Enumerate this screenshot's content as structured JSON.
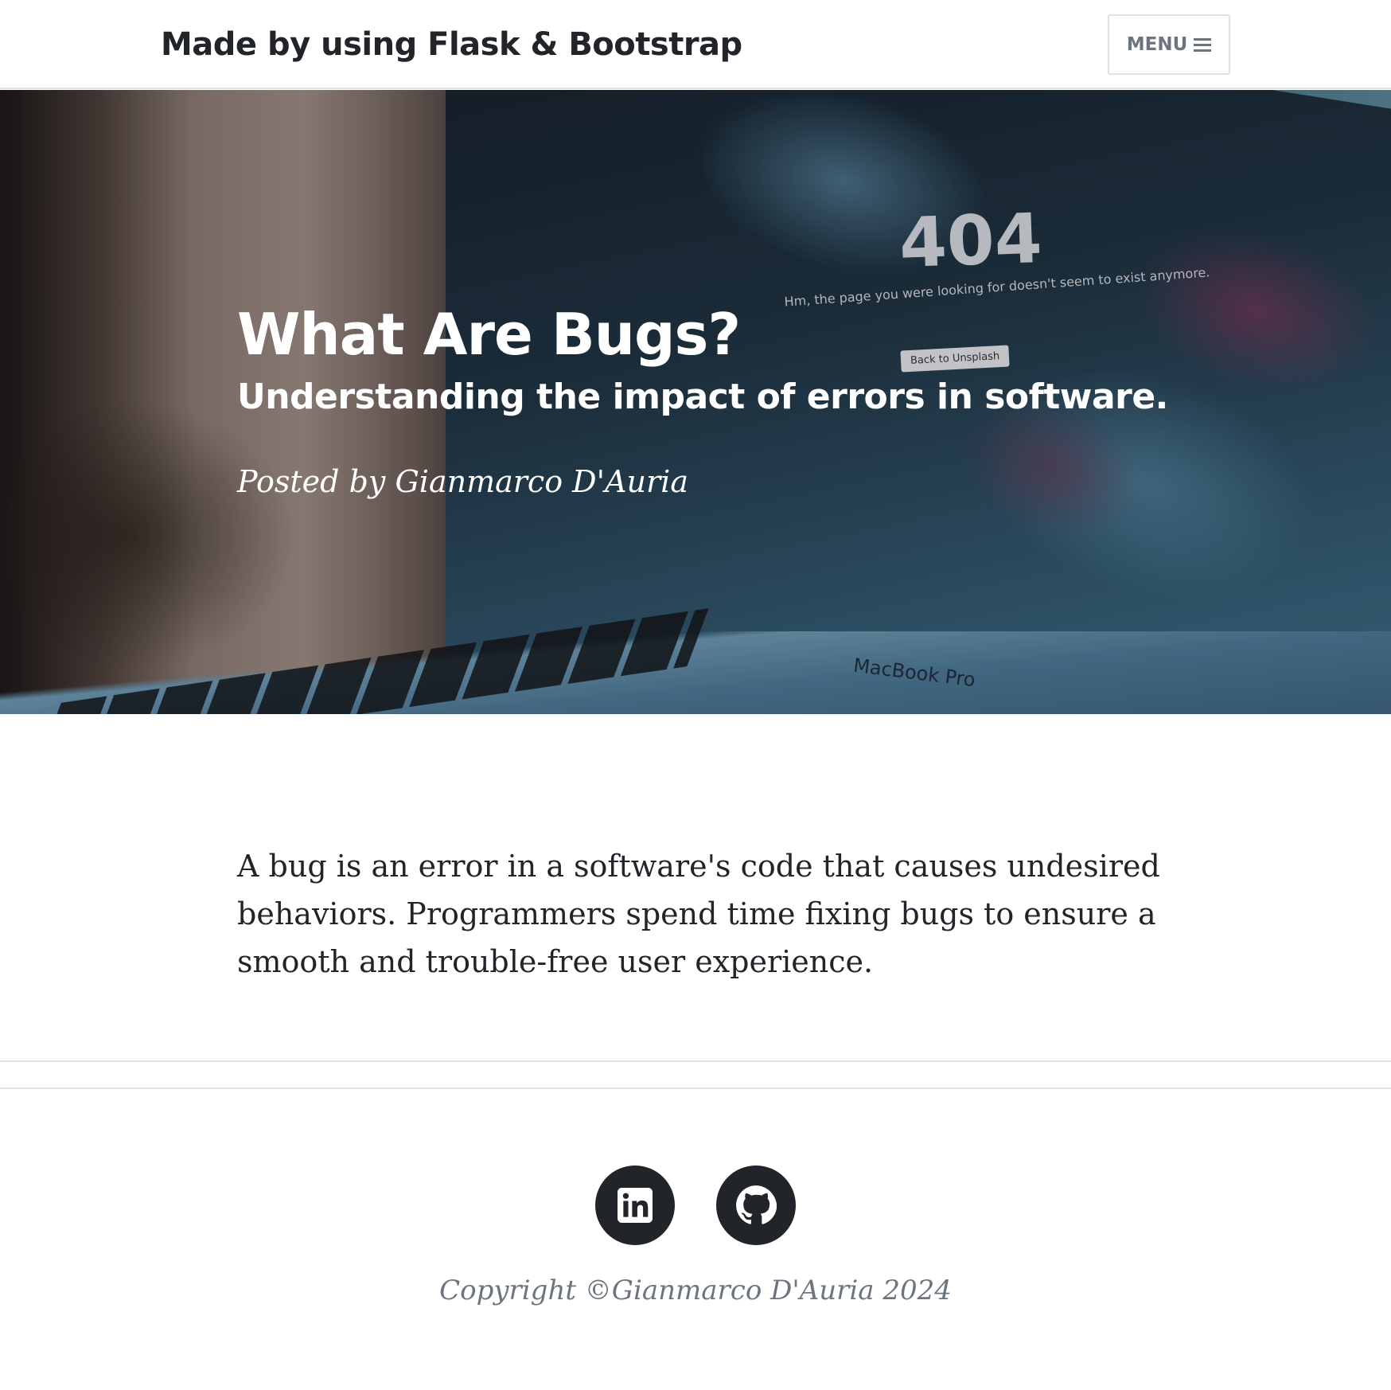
{
  "navbar": {
    "brand": "Made by using Flask & Bootstrap",
    "menu_label": "MENU",
    "menu_icon": "bars-icon"
  },
  "hero": {
    "title": "What Are Bugs?",
    "subtitle": "Understanding the impact of errors in software.",
    "meta": "Posted by Gianmarco D'Auria",
    "image_text": {
      "error_code": "404",
      "message": "Hm, the page you were looking for doesn't seem to exist anymore.",
      "button": "Back to Unsplash",
      "laptop_label": "MacBook Pro"
    }
  },
  "article": {
    "body": "A bug is an error in a software's code that causes undesired behaviors. Programmers spend time fixing bugs to ensure a smooth and trouble-free user experience."
  },
  "footer": {
    "social": [
      {
        "name": "linkedin",
        "icon": "linkedin-icon"
      },
      {
        "name": "github",
        "icon": "github-icon"
      }
    ],
    "copyright": "Copyright ©Gianmarco D'Auria 2024"
  },
  "colors": {
    "text": "#212529",
    "muted": "#6c757d",
    "border": "#dee2e6",
    "hero_text": "#ffffff"
  }
}
